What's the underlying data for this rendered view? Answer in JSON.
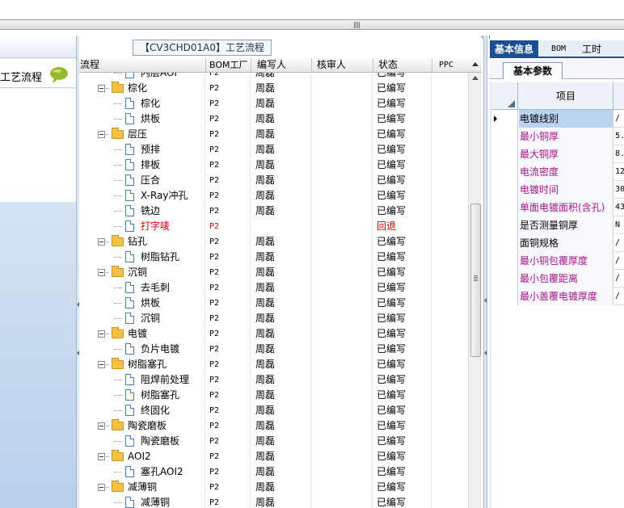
{
  "left_panel": {
    "item_label": "工艺流程"
  },
  "center": {
    "title": "【CV3CHD01A0】工艺流程",
    "columns": [
      {
        "key": "name",
        "label": "流程"
      },
      {
        "key": "bom",
        "label": "BOM工厂"
      },
      {
        "key": "author",
        "label": "编写人"
      },
      {
        "key": "reviewer",
        "label": "核审人"
      },
      {
        "key": "status",
        "label": "状态"
      },
      {
        "key": "ppc",
        "label": "PPC"
      }
    ],
    "rows": [
      {
        "level": 1,
        "kind": "doc",
        "name": "内层AOI",
        "bom": "P2",
        "author": "周磊",
        "reviewer": "",
        "status": "已编写",
        "ppc": ""
      },
      {
        "level": 0,
        "kind": "folder",
        "name": "棕化",
        "bom": "P2",
        "author": "周磊",
        "reviewer": "",
        "status": "已编写",
        "ppc": ""
      },
      {
        "level": 1,
        "kind": "doc",
        "name": "棕化",
        "bom": "P2",
        "author": "周磊",
        "reviewer": "",
        "status": "已编写",
        "ppc": ""
      },
      {
        "level": 1,
        "kind": "doc",
        "name": "烘板",
        "bom": "P2",
        "author": "周磊",
        "reviewer": "",
        "status": "已编写",
        "ppc": ""
      },
      {
        "level": 0,
        "kind": "folder",
        "name": "层压",
        "bom": "P2",
        "author": "周磊",
        "reviewer": "",
        "status": "已编写",
        "ppc": ""
      },
      {
        "level": 1,
        "kind": "doc",
        "name": "预排",
        "bom": "P2",
        "author": "周磊",
        "reviewer": "",
        "status": "已编写",
        "ppc": ""
      },
      {
        "level": 1,
        "kind": "doc",
        "name": "排板",
        "bom": "P2",
        "author": "周磊",
        "reviewer": "",
        "status": "已编写",
        "ppc": ""
      },
      {
        "level": 1,
        "kind": "doc",
        "name": "压合",
        "bom": "P2",
        "author": "周磊",
        "reviewer": "",
        "status": "已编写",
        "ppc": ""
      },
      {
        "level": 1,
        "kind": "doc",
        "name": "X-Ray冲孔",
        "bom": "P2",
        "author": "周磊",
        "reviewer": "",
        "status": "已编写",
        "ppc": ""
      },
      {
        "level": 1,
        "kind": "doc",
        "name": "铣边",
        "bom": "P2",
        "author": "周磊",
        "reviewer": "",
        "status": "已编写",
        "ppc": ""
      },
      {
        "level": 1,
        "kind": "doc",
        "name": "打字唛",
        "bom": "P2",
        "author": "",
        "reviewer": "",
        "status": "回退",
        "ppc": "",
        "highlight": true
      },
      {
        "level": 0,
        "kind": "folder",
        "name": "钻孔",
        "bom": "P2",
        "author": "周磊",
        "reviewer": "",
        "status": "已编写",
        "ppc": ""
      },
      {
        "level": 1,
        "kind": "doc",
        "name": "树脂钻孔",
        "bom": "P2",
        "author": "周磊",
        "reviewer": "",
        "status": "已编写",
        "ppc": ""
      },
      {
        "level": 0,
        "kind": "folder",
        "name": "沉铜",
        "bom": "P2",
        "author": "周磊",
        "reviewer": "",
        "status": "已编写",
        "ppc": ""
      },
      {
        "level": 1,
        "kind": "doc",
        "name": "去毛刺",
        "bom": "P2",
        "author": "周磊",
        "reviewer": "",
        "status": "已编写",
        "ppc": ""
      },
      {
        "level": 1,
        "kind": "doc",
        "name": "烘板",
        "bom": "P2",
        "author": "周磊",
        "reviewer": "",
        "status": "已编写",
        "ppc": ""
      },
      {
        "level": 1,
        "kind": "doc",
        "name": "沉铜",
        "bom": "P2",
        "author": "周磊",
        "reviewer": "",
        "status": "已编写",
        "ppc": ""
      },
      {
        "level": 0,
        "kind": "folder",
        "name": "电镀",
        "bom": "P2",
        "author": "周磊",
        "reviewer": "",
        "status": "已编写",
        "ppc": ""
      },
      {
        "level": 1,
        "kind": "doc",
        "name": "负片电镀",
        "bom": "P2",
        "author": "周磊",
        "reviewer": "",
        "status": "已编写",
        "ppc": ""
      },
      {
        "level": 0,
        "kind": "folder",
        "name": "树脂塞孔",
        "bom": "P2",
        "author": "周磊",
        "reviewer": "",
        "status": "已编写",
        "ppc": ""
      },
      {
        "level": 1,
        "kind": "doc",
        "name": "阻焊前处理",
        "bom": "P2",
        "author": "周磊",
        "reviewer": "",
        "status": "已编写",
        "ppc": ""
      },
      {
        "level": 1,
        "kind": "doc",
        "name": "树脂塞孔",
        "bom": "P2",
        "author": "周磊",
        "reviewer": "",
        "status": "已编写",
        "ppc": ""
      },
      {
        "level": 1,
        "kind": "doc",
        "name": "终固化",
        "bom": "P2",
        "author": "周磊",
        "reviewer": "",
        "status": "已编写",
        "ppc": ""
      },
      {
        "level": 0,
        "kind": "folder",
        "name": "陶瓷磨板",
        "bom": "P2",
        "author": "周磊",
        "reviewer": "",
        "status": "已编写",
        "ppc": ""
      },
      {
        "level": 1,
        "kind": "doc",
        "name": "陶瓷磨板",
        "bom": "P2",
        "author": "周磊",
        "reviewer": "",
        "status": "已编写",
        "ppc": ""
      },
      {
        "level": 0,
        "kind": "folder",
        "name": "AOI2",
        "bom": "P2",
        "author": "周磊",
        "reviewer": "",
        "status": "已编写",
        "ppc": ""
      },
      {
        "level": 1,
        "kind": "doc",
        "name": "塞孔AOI2",
        "bom": "P2",
        "author": "周磊",
        "reviewer": "",
        "status": "已编写",
        "ppc": ""
      },
      {
        "level": 0,
        "kind": "folder",
        "name": "减薄铜",
        "bom": "P2",
        "author": "周磊",
        "reviewer": "",
        "status": "已编写",
        "ppc": ""
      },
      {
        "level": 1,
        "kind": "doc",
        "name": "减薄铜",
        "bom": "P2",
        "author": "周磊",
        "reviewer": "",
        "status": "已编写",
        "ppc": ""
      }
    ]
  },
  "right_panel": {
    "tabs": [
      {
        "label": "基本信息",
        "active": true
      },
      {
        "label": "BOM",
        "active": false
      },
      {
        "label": "工时",
        "active": false
      }
    ],
    "subtab": "基本参数",
    "column_header": "项目",
    "params": [
      {
        "name": "电镀线别",
        "value": "/",
        "selected": true,
        "color": "black"
      },
      {
        "name": "最小铜厚",
        "value": "5.",
        "color": "magenta"
      },
      {
        "name": "最大铜厚",
        "value": "8.",
        "color": "magenta"
      },
      {
        "name": "电流密度",
        "value": "12",
        "color": "magenta"
      },
      {
        "name": "电镀时间",
        "value": "30",
        "color": "magenta"
      },
      {
        "name": "单面电镀面积(含孔)",
        "value": "43",
        "color": "magenta"
      },
      {
        "name": "是否测量铜厚",
        "value": "N",
        "color": "black"
      },
      {
        "name": "面铜规格",
        "value": "/",
        "color": "black"
      },
      {
        "name": "最小铜包覆厚度",
        "value": "/",
        "color": "magenta"
      },
      {
        "name": "最小包覆距离",
        "value": "/",
        "color": "magenta"
      },
      {
        "name": "最小盖覆电镀厚度",
        "value": "/",
        "color": "magenta"
      }
    ]
  }
}
